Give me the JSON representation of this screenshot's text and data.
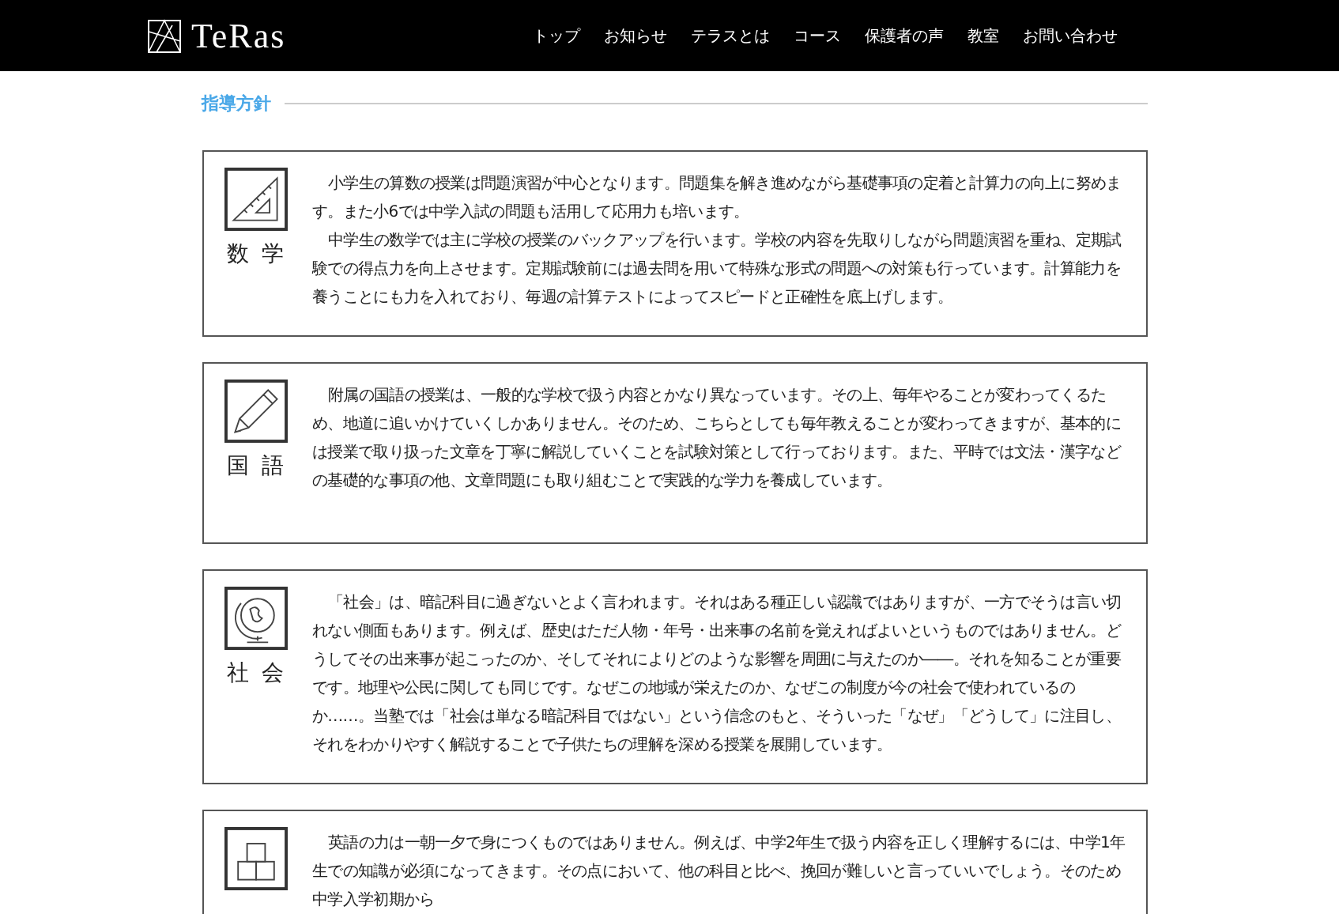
{
  "header": {
    "logo": "TeRas",
    "nav": [
      "トップ",
      "お知らせ",
      "テラスとは",
      "コース",
      "保護者の声",
      "教室",
      "お問い合わせ"
    ]
  },
  "section_title": "指導方針",
  "subjects": [
    {
      "kind": "ruler",
      "label": "数学",
      "paragraphs": [
        "小学生の算数の授業は問題演習が中心となります。問題集を解き進めながら基礎事項の定着と計算力の向上に努めます。また小6では中学入試の問題も活用して応用力も培います。",
        "中学生の数学では主に学校の授業のバックアップを行います。学校の内容を先取りしながら問題演習を重ね、定期試験での得点力を向上させます。定期試験前には過去問を用いて特殊な形式の問題への対策も行っています。計算能力を養うことにも力を入れており、毎週の計算テストによってスピードと正確性を底上げします。"
      ]
    },
    {
      "kind": "pencil",
      "label": "国語",
      "paragraphs": [
        "附属の国語の授業は、一般的な学校で扱う内容とかなり異なっています。その上、毎年やることが変わってくるため、地道に追いかけていくしかありません。そのため、こちらとしても毎年教えることが変わってきますが、基本的には授業で取り扱った文章を丁寧に解説していくことを試験対策として行っております。また、平時では文法・漢字などの基礎的な事項の他、文章問題にも取り組むことで実践的な学力を養成しています。"
      ]
    },
    {
      "kind": "globe",
      "label": "社会",
      "paragraphs": [
        "「社会」は、暗記科目に過ぎないとよく言われます。それはある種正しい認識ではありますが、一方でそうは言い切れない側面もあります。例えば、歴史はただ人物・年号・出来事の名前を覚えればよいというものではありません。どうしてその出来事が起こったのか、そしてそれによりどのような影響を周囲に与えたのか――。それを知ることが重要です。地理や公民に関しても同じです。なぜこの地域が栄えたのか、なぜこの制度が今の社会で使われているのか……。当塾では「社会は単なる暗記科目ではない」という信念のもと、そういった「なぜ」「どうして」に注目し、それをわかりやすく解説することで子供たちの理解を深める授業を展開しています。"
      ]
    },
    {
      "kind": "blocks",
      "paragraphs": [
        "英語の力は一朝一夕で身につくものではありません。例えば、中学2年生で扱う内容を正しく理解するには、中学1年生での知識が必須になってきます。その点において、他の科目と比べ、挽回が難しいと言っていいでしょう。そのため中学入学初期から"
      ]
    }
  ]
}
